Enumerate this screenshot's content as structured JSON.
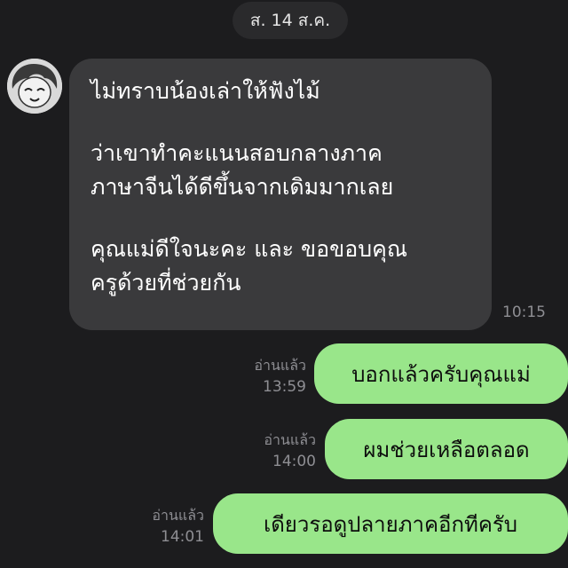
{
  "date_label": "ส. 14 ส.ค.",
  "incoming": {
    "lines": [
      "ไม่ทราบน้องเล่าให้ฟังไม้",
      "",
      "ว่าเขาทำคะแนนสอบกลางภาค",
      "ภาษาจีนได้ดีขึ้นจากเดิมมากเลย",
      "",
      "คุณแม่ดีใจนะคะ และ ขอขอบคุณ",
      "ครูด้วยที่ช่วยกัน"
    ],
    "time": "10:15"
  },
  "outgoing": [
    {
      "text": "บอกแล้วครับคุณแม่",
      "read": "อ่านแล้ว",
      "time": "13:59"
    },
    {
      "text": "ผมช่วยเหลือตลอด",
      "read": "อ่านแล้ว",
      "time": "14:00"
    },
    {
      "text": "เดียวรอดูปลายภาคอีกทีครับ",
      "read": "อ่านแล้ว",
      "time": "14:01"
    }
  ],
  "colors": {
    "background": "#1c1c1e",
    "incoming_bubble": "#3a3a3c",
    "outgoing_bubble": "#99e68a"
  }
}
